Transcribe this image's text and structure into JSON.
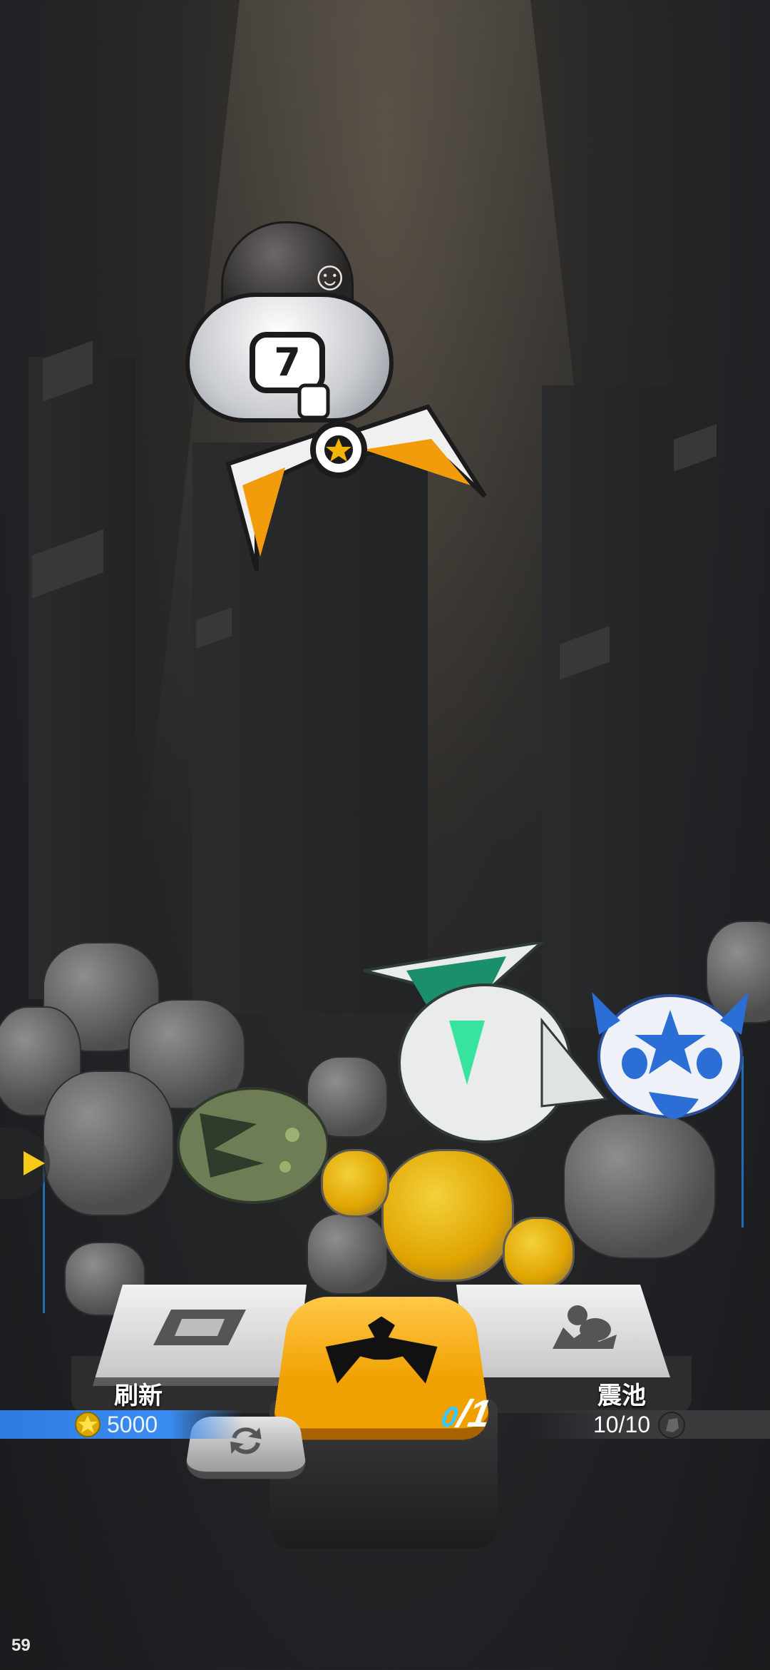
{
  "hud": {
    "fps": "59"
  },
  "machine": {
    "pod_number": "7",
    "character_icon": "silver-haired-chibi-character"
  },
  "prizes": [
    {
      "icon": "green-white-mech-head"
    },
    {
      "icon": "blue-white-spiked-pod"
    },
    {
      "icon": "camo-rock-egg"
    }
  ],
  "controls": {
    "refresh": {
      "label": "刷新",
      "icon": "refresh-box-icon",
      "cost_icon": "gold-star-coin-icon",
      "cost": "5000"
    },
    "grab": {
      "icon": "claw-icon",
      "count_current": "0",
      "count_separator": "/",
      "count_total": "1"
    },
    "swap": {
      "icon": "swap-arrows-icon"
    },
    "pool": {
      "label": "震池",
      "icon": "pool-pile-icon",
      "count": "10/10",
      "count_icon": "ore-icon"
    },
    "side_arrow_icon": "play-arrow-icon"
  },
  "colors": {
    "accent_orange": "#F3A70A",
    "cost_blue": "#3B8CF1",
    "count_cyan": "#35C8FF"
  }
}
